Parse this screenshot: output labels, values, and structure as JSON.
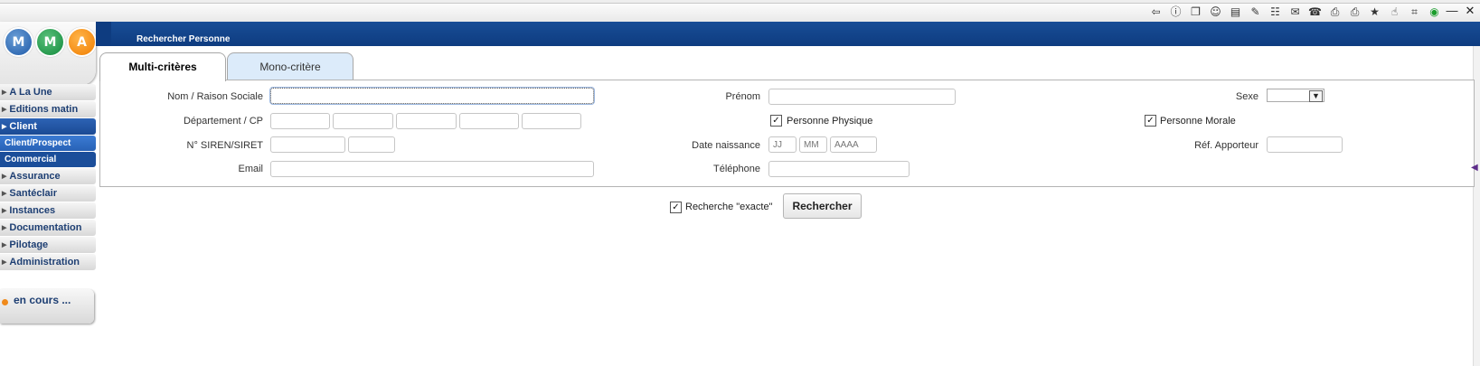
{
  "toolbar": {
    "icons": [
      {
        "name": "logout-icon",
        "glyph": "⇦"
      },
      {
        "name": "info-icon",
        "glyph": "ⓘ"
      },
      {
        "name": "copy-icon",
        "glyph": "❐"
      },
      {
        "name": "smiley-icon",
        "glyph": "☺"
      },
      {
        "name": "card-icon",
        "glyph": "▤"
      },
      {
        "name": "edit-icon",
        "glyph": "✎"
      },
      {
        "name": "users-icon",
        "glyph": "☷"
      },
      {
        "name": "mail-icon",
        "glyph": "✉"
      },
      {
        "name": "phone-icon",
        "glyph": "☎"
      },
      {
        "name": "print-icon",
        "glyph": "⎙"
      },
      {
        "name": "print-alt-icon",
        "glyph": "⎙"
      },
      {
        "name": "star-icon",
        "glyph": "★"
      },
      {
        "name": "hand-icon",
        "glyph": "☝"
      },
      {
        "name": "plug-icon",
        "glyph": "⌗"
      },
      {
        "name": "status-icon",
        "glyph": "◉"
      }
    ],
    "window": {
      "minimize": "—",
      "close": "✕"
    }
  },
  "logo": {
    "letters": [
      "M",
      "M",
      "A"
    ]
  },
  "sidebar": {
    "items": [
      {
        "label": "A La Une",
        "type": "item"
      },
      {
        "label": "Editions matin",
        "type": "item"
      },
      {
        "label": "Client",
        "type": "active"
      },
      {
        "label": "Client/Prospect",
        "type": "sub-selected"
      },
      {
        "label": "Commercial",
        "type": "sub"
      },
      {
        "label": "Assurance",
        "type": "item"
      },
      {
        "label": "Santéclair",
        "type": "item"
      },
      {
        "label": "Instances",
        "type": "item"
      },
      {
        "label": "Documentation",
        "type": "item"
      },
      {
        "label": "Pilotage",
        "type": "item"
      },
      {
        "label": "Administration",
        "type": "item"
      }
    ],
    "status": "en cours ..."
  },
  "header": {
    "title": "Rechercher Personne"
  },
  "tabs": [
    {
      "label": "Multi-critères",
      "active": true
    },
    {
      "label": "Mono-critère",
      "active": false
    }
  ],
  "form": {
    "nom_label": "Nom / Raison Sociale",
    "prenom_label": "Prénom",
    "sexe_label": "Sexe",
    "departement_label": "Département / CP",
    "personne_physique_label": "Personne Physique",
    "personne_physique_checked": true,
    "personne_morale_label": "Personne Morale",
    "personne_morale_checked": true,
    "siren_label": "N° SIREN/SIRET",
    "date_naissance_label": "Date naissance",
    "date_placeholders": {
      "day": "JJ",
      "month": "MM",
      "year": "AAAA"
    },
    "ref_apporteur_label": "Réf. Apporteur",
    "email_label": "Email",
    "telephone_label": "Téléphone"
  },
  "actions": {
    "recherche_exacte_label": "Recherche \"exacte\"",
    "recherche_exacte_checked": true,
    "search_button": "Rechercher"
  }
}
